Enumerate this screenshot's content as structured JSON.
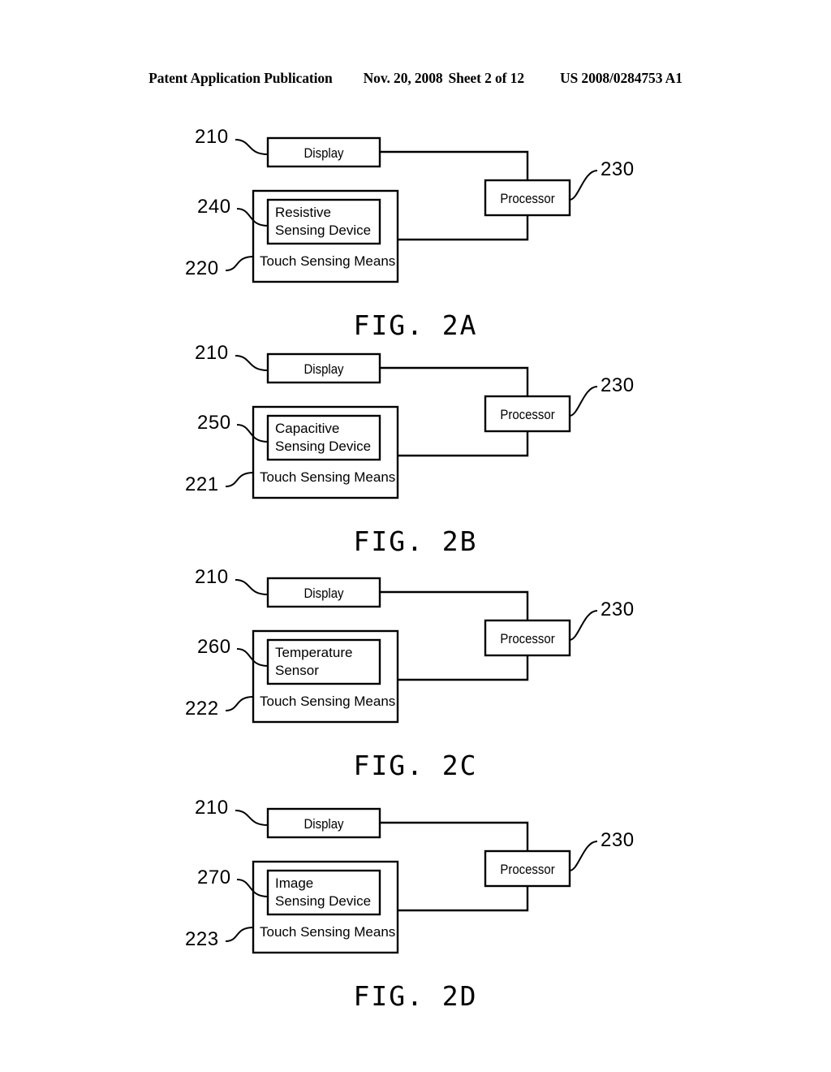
{
  "header": {
    "publication": "Patent Application Publication",
    "date": "Nov. 20, 2008",
    "sheet": "Sheet 2 of 12",
    "patent_number": "US 2008/0284753 A1"
  },
  "common": {
    "display_label": "Display",
    "processor_label": "Processor",
    "touch_sensing_label": "Touch Sensing Means",
    "display_ref": "210",
    "processor_ref": "230",
    "line_color": "#000000"
  },
  "figures": [
    {
      "caption": "FIG. 2A",
      "display_label": "Display",
      "display_ref": "210",
      "processor_label": "Processor",
      "processor_ref": "230",
      "touch_sensing_label": "Touch Sensing Means",
      "touch_sensing_ref": "220",
      "sensor_ref": "240",
      "sensor_line1": "Resistive",
      "sensor_line2": "Sensing  Device"
    },
    {
      "caption": "FIG. 2B",
      "display_label": "Display",
      "display_ref": "210",
      "processor_label": "Processor",
      "processor_ref": "230",
      "touch_sensing_label": "Touch Sensing Means",
      "touch_sensing_ref": "221",
      "sensor_ref": "250",
      "sensor_line1": "Capacitive",
      "sensor_line2": "Sensing  Device"
    },
    {
      "caption": "FIG. 2C",
      "display_label": "Display",
      "display_ref": "210",
      "processor_label": "Processor",
      "processor_ref": "230",
      "touch_sensing_label": "Touch Sensing Means",
      "touch_sensing_ref": "222",
      "sensor_ref": "260",
      "sensor_line1": "Temperature",
      "sensor_line2": "Sensor"
    },
    {
      "caption": "FIG. 2D",
      "display_label": "Display",
      "display_ref": "210",
      "processor_label": "Processor",
      "processor_ref": "230",
      "touch_sensing_label": "Touch Sensing Means",
      "touch_sensing_ref": "223",
      "sensor_ref": "270",
      "sensor_line1": "Image",
      "sensor_line2": "Sensing  Device"
    }
  ]
}
